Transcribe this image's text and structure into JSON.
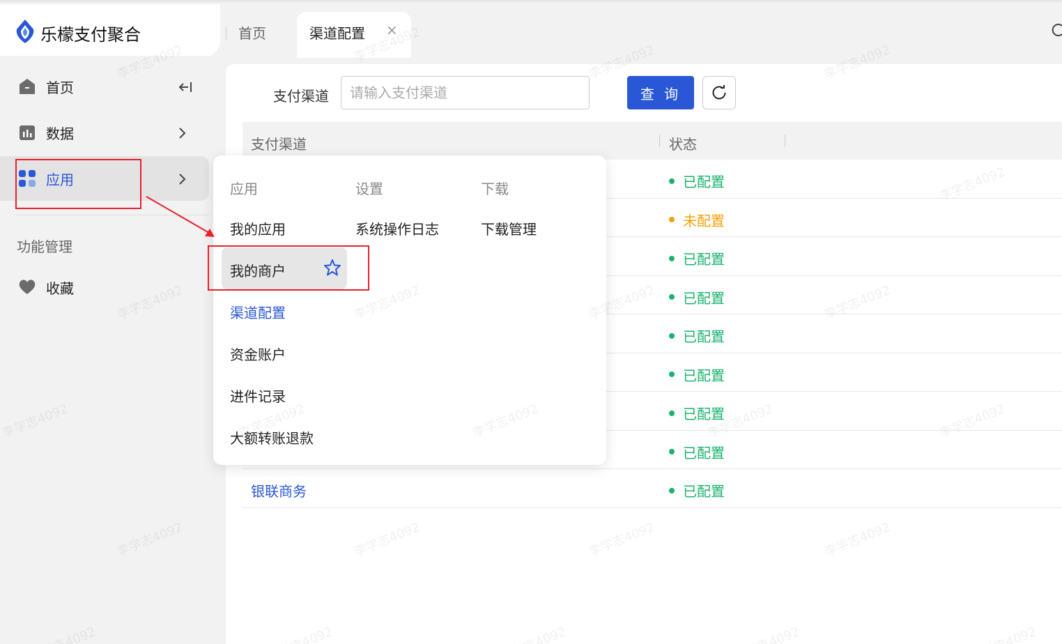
{
  "app": {
    "title": "乐檬支付聚合"
  },
  "tabs": [
    {
      "label": "首页"
    },
    {
      "label": "渠道配置",
      "close": "×"
    }
  ],
  "sidebar": {
    "items": [
      {
        "label": "首页",
        "icon": "home-icon"
      },
      {
        "label": "数据",
        "icon": "chart-icon"
      },
      {
        "label": "应用",
        "icon": "grid-icon"
      }
    ],
    "collapse_icon": "collapse-icon",
    "section_title": "功能管理",
    "favorites_label": "收藏"
  },
  "filter": {
    "label": "支付渠道",
    "placeholder": "请输入支付渠道",
    "value": "",
    "query_button": "查 询"
  },
  "table": {
    "headers": [
      "支付渠道",
      "状态"
    ],
    "rows": [
      {
        "name": "",
        "status": "已配置",
        "status_type": "configured"
      },
      {
        "name": "",
        "status": "未配置",
        "status_type": "unconfigured"
      },
      {
        "name": "",
        "status": "已配置",
        "status_type": "configured"
      },
      {
        "name": "",
        "status": "已配置",
        "status_type": "configured"
      },
      {
        "name": "",
        "status": "已配置",
        "status_type": "configured"
      },
      {
        "name": "",
        "status": "已配置",
        "status_type": "configured"
      },
      {
        "name": "",
        "status": "已配置",
        "status_type": "configured"
      },
      {
        "name": "",
        "status": "已配置",
        "status_type": "configured"
      },
      {
        "name": "银联商务",
        "status": "已配置",
        "status_type": "configured"
      }
    ]
  },
  "dropdown_menu": {
    "columns": [
      {
        "title": "应用",
        "items": [
          "我的应用",
          "我的商户",
          "渠道配置",
          "资金账户",
          "进件记录",
          "大额转账退款"
        ]
      },
      {
        "title": "设置",
        "items": [
          "系统操作日志"
        ]
      },
      {
        "title": "下载",
        "items": [
          "下载管理"
        ]
      }
    ],
    "highlighted_item": "我的商户",
    "active_item": "渠道配置"
  },
  "watermark": {
    "text": "李学志4092"
  },
  "colors": {
    "brand_blue": "#2a57d6",
    "configured_green": "#19b36b",
    "unconfigured_orange": "#f5a00a",
    "annotation_red": "#e8202a"
  }
}
